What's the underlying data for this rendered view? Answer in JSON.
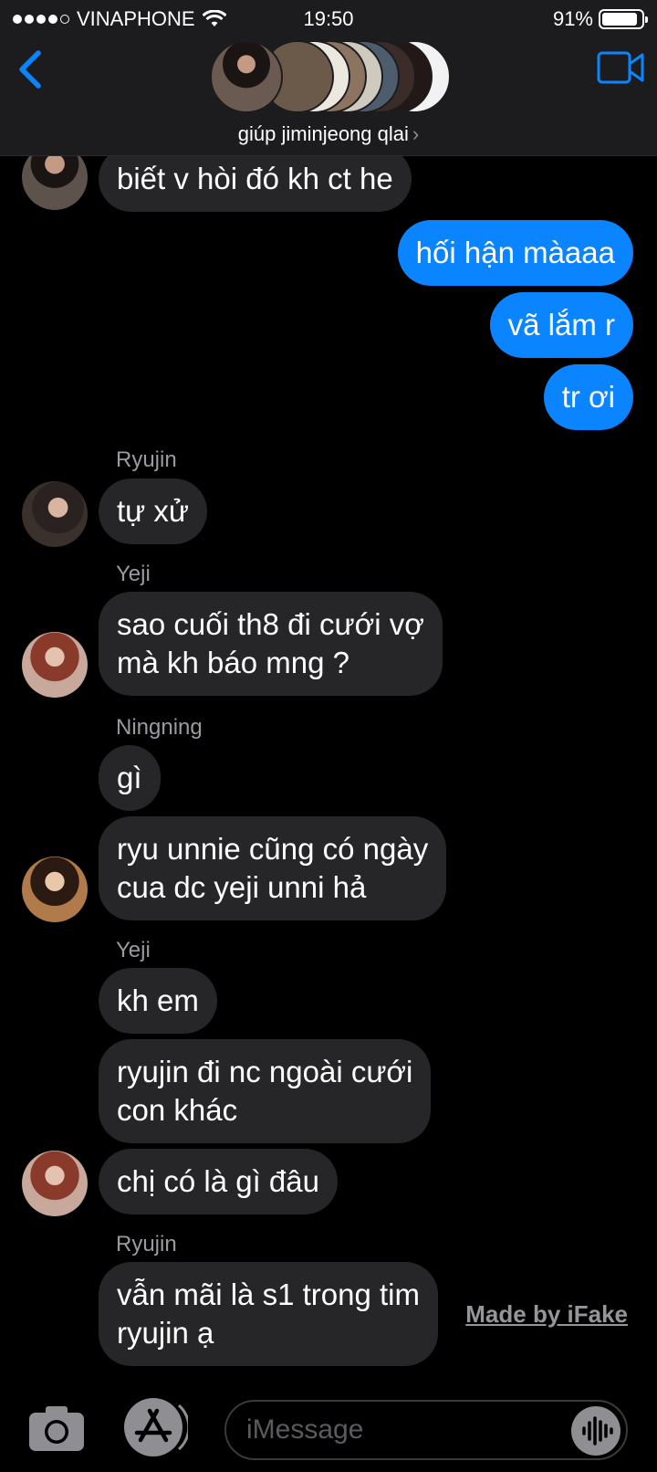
{
  "status_bar": {
    "carrier": "VINAPHONE",
    "time": "19:50",
    "battery": "91%",
    "battery_level": 0.91
  },
  "header": {
    "group_name": "giúp jiminjeong qlai",
    "chevron": "›",
    "back_icon": "chevron-left-icon",
    "video_icon": "video-camera-icon"
  },
  "messages": [
    {
      "dir": "in",
      "text": "biết v hòi đó kh ct he"
    },
    {
      "dir": "out",
      "text": "hối hận màaaa"
    },
    {
      "dir": "out",
      "text": "vã lắm r"
    },
    {
      "dir": "out",
      "text": "tr ơi"
    },
    {
      "dir": "in",
      "sender": "Ryujin",
      "text": "tự xử"
    },
    {
      "dir": "in",
      "sender": "Yeji",
      "text": "sao cuối th8 đi cưới vợ\nmà kh báo mng ?"
    },
    {
      "dir": "in",
      "sender": "Ningning",
      "text": "gì"
    },
    {
      "dir": "in",
      "text": "ryu unnie cũng có ngày\ncua dc yeji unni hả"
    },
    {
      "dir": "in",
      "sender": "Yeji",
      "text": "kh em"
    },
    {
      "dir": "in",
      "text": "ryujin đi nc ngoài cưới\ncon khác"
    },
    {
      "dir": "in",
      "text": "chị có là gì đâu"
    },
    {
      "dir": "in",
      "sender": "Ryujin",
      "text": "vẫn mãi là s1 trong tim\nryujin ạ"
    }
  ],
  "watermark": "Made by iFake",
  "input": {
    "placeholder": "iMessage",
    "camera_icon": "camera-icon",
    "apps_icon": "app-store-icon",
    "audio_icon": "audio-waveform-icon"
  },
  "colors": {
    "outgoing_bubble": "#0A84FF",
    "incoming_bubble": "#262628",
    "background": "#000000",
    "accent": "#0A84FF"
  }
}
